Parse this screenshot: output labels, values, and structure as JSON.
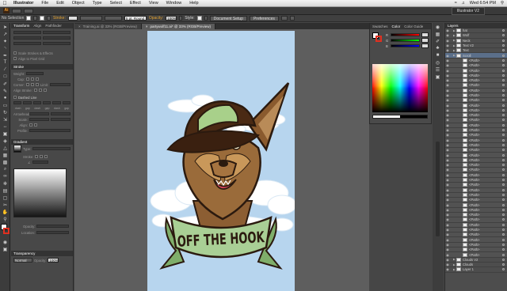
{
  "menubar": {
    "app_name": "Illustrator",
    "items": [
      "File",
      "Edit",
      "Object",
      "Type",
      "Select",
      "Effect",
      "View",
      "Window",
      "Help"
    ],
    "clock": "Wed 6:54 PM"
  },
  "appbar": {
    "workspace": "Illustrator V2"
  },
  "control_bar": {
    "selection": "No Selection",
    "stroke_label": "Stroke:",
    "brush": "5 pt. Round",
    "opacity_label": "Opacity:",
    "opacity": "100%",
    "style_label": "Style:",
    "document_setup": "Document Setup",
    "preferences": "Preferences"
  },
  "left_panel": {
    "tabs": [
      "Transform",
      "Align",
      "Pathfinder"
    ],
    "scale_strokes": "Scale Strokes & Effects",
    "align_pixel": "Align to Pixel Grid",
    "stroke_tab": "Stroke",
    "weight_label": "Weight:",
    "cap_label": "Cap:",
    "corner_label": "Corner:",
    "limit_label": "Limit:",
    "align_stroke_label": "Align Stroke:",
    "dashed_line": "Dashed Line",
    "dash_labels": [
      "dash",
      "gap",
      "dash",
      "gap",
      "dash",
      "gap"
    ],
    "arrowheads_label": "Arrowheads:",
    "scale_label": "Scale:",
    "align_label": "Align:",
    "profile_label": "Profile:",
    "gradient_tab": "Gradient",
    "type_label": "Type:",
    "stroke_sm": "Stroke:",
    "opacity_sm": "Opacity:",
    "location_sm": "Location:",
    "transparency_tab": "Transparency",
    "blend_mode": "Normal",
    "opacity_label": "Opacity:",
    "opacity_value": "100%"
  },
  "document_tabs": [
    {
      "label": "Training.ai @ 33% (RGB/Preview)",
      "active": false
    },
    {
      "label": "partywolf11.ai* @ 33% (RGB/Preview)",
      "active": true
    }
  ],
  "artwork": {
    "banner_text": "OFF THE HOOK",
    "colors": {
      "sky": "#b7d5ee",
      "cap": "#4a2a14",
      "cap_accent": "#a8d08a",
      "fur": "#9a6b3a",
      "banner": "#a9cf95",
      "outline": "#2b1a0f"
    }
  },
  "color_panel": {
    "tabs": [
      "Swatches",
      "Color",
      "Color Guide"
    ],
    "channels": [
      "R",
      "G",
      "B"
    ]
  },
  "layers_panel": {
    "tab": "Layers",
    "rows": [
      {
        "name": "hat",
        "indent": 0
      },
      {
        "name": "Wolf",
        "indent": 0
      },
      {
        "name": "Neck",
        "indent": 0
      },
      {
        "name": "Text V2",
        "indent": 0
      },
      {
        "name": "Text",
        "indent": 0
      },
      {
        "name": "Scroll",
        "indent": 0
      },
      {
        "name": "<Path>",
        "indent": 1
      },
      {
        "name": "<Path>",
        "indent": 1
      },
      {
        "name": "<Path>",
        "indent": 1
      },
      {
        "name": "<Path>",
        "indent": 1
      },
      {
        "name": "<Path>",
        "indent": 1
      },
      {
        "name": "<Path>",
        "indent": 1
      },
      {
        "name": "<Path>",
        "indent": 1
      },
      {
        "name": "<Path>",
        "indent": 1
      },
      {
        "name": "<Path>",
        "indent": 1
      },
      {
        "name": "<Path>",
        "indent": 1
      },
      {
        "name": "<Path>",
        "indent": 1
      },
      {
        "name": "<Path>",
        "indent": 1
      },
      {
        "name": "<Path>",
        "indent": 1
      },
      {
        "name": "<Path>",
        "indent": 1
      },
      {
        "name": "<Path>",
        "indent": 1
      },
      {
        "name": "<Path>",
        "indent": 1
      },
      {
        "name": "<Path>",
        "indent": 1
      },
      {
        "name": "<Path>",
        "indent": 1
      },
      {
        "name": "<Path>",
        "indent": 1
      },
      {
        "name": "<Path>",
        "indent": 1
      },
      {
        "name": "<Path>",
        "indent": 1
      },
      {
        "name": "<Path>",
        "indent": 1
      },
      {
        "name": "<Path>",
        "indent": 1
      },
      {
        "name": "<Path>",
        "indent": 1
      },
      {
        "name": "<Path>",
        "indent": 1
      },
      {
        "name": "<Path>",
        "indent": 1
      },
      {
        "name": "<Path>",
        "indent": 1
      },
      {
        "name": "<Path>",
        "indent": 1
      },
      {
        "name": "<Path>",
        "indent": 1
      },
      {
        "name": "<Path>",
        "indent": 1
      },
      {
        "name": "<Path>",
        "indent": 1
      },
      {
        "name": "<Path>",
        "indent": 1
      },
      {
        "name": "<Path>",
        "indent": 1
      },
      {
        "name": "<Path>",
        "indent": 1
      },
      {
        "name": "<Path>",
        "indent": 1
      },
      {
        "name": "<Path>",
        "indent": 1
      },
      {
        "name": "<Path>",
        "indent": 1
      },
      {
        "name": "<Path>",
        "indent": 1
      },
      {
        "name": "<Path>",
        "indent": 1
      },
      {
        "name": "<Path>",
        "indent": 1
      },
      {
        "name": "Clouds V2",
        "indent": 0
      },
      {
        "name": "Clouds",
        "indent": 0
      },
      {
        "name": "Layer 1",
        "indent": 0
      }
    ]
  }
}
